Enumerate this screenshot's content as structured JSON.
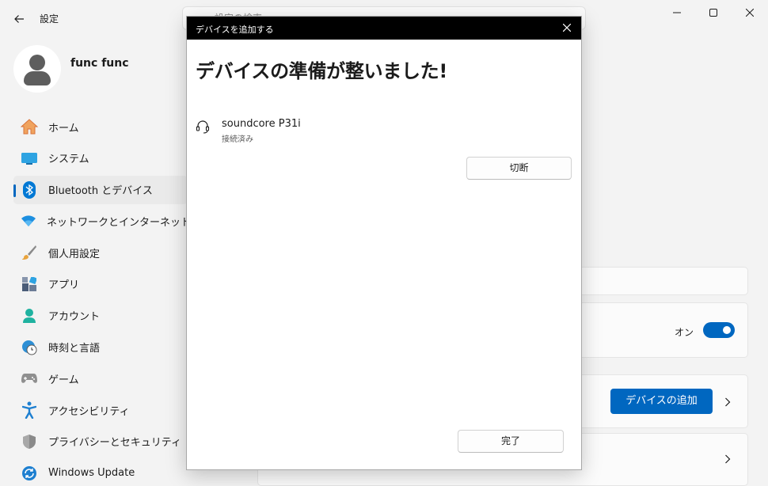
{
  "window": {
    "app_title": "設定",
    "search_placeholder": "設定の検索"
  },
  "profile": {
    "name": "func func"
  },
  "sidebar": {
    "items": [
      {
        "label": "ホーム",
        "icon": "home-icon"
      },
      {
        "label": "システム",
        "icon": "system-icon"
      },
      {
        "label": "Bluetooth とデバイス",
        "icon": "bluetooth-icon",
        "active": true
      },
      {
        "label": "ネットワークとインターネット",
        "icon": "wifi-icon"
      },
      {
        "label": "個人用設定",
        "icon": "brush-icon"
      },
      {
        "label": "アプリ",
        "icon": "apps-icon"
      },
      {
        "label": "アカウント",
        "icon": "account-icon"
      },
      {
        "label": "時刻と言語",
        "icon": "clock-globe-icon"
      },
      {
        "label": "ゲーム",
        "icon": "gamepad-icon"
      },
      {
        "label": "アクセシビリティ",
        "icon": "accessibility-icon"
      },
      {
        "label": "プライバシーとセキュリティ",
        "icon": "shield-icon"
      },
      {
        "label": "Windows Update",
        "icon": "update-icon"
      }
    ]
  },
  "content": {
    "bluetooth_toggle_label": "オン",
    "bluetooth_toggle_on": true,
    "add_device_label": "デバイスの追加"
  },
  "dialog": {
    "title": "デバイスを追加する",
    "heading": "デバイスの準備が整いました!",
    "device": {
      "name": "soundcore P31i",
      "status": "接続済み",
      "icon": "headset-icon"
    },
    "disconnect_label": "切断",
    "done_label": "完了"
  },
  "colors": {
    "accent": "#0067c0",
    "dialog_titlebar": "#000000",
    "background": "#f3f3f3"
  }
}
